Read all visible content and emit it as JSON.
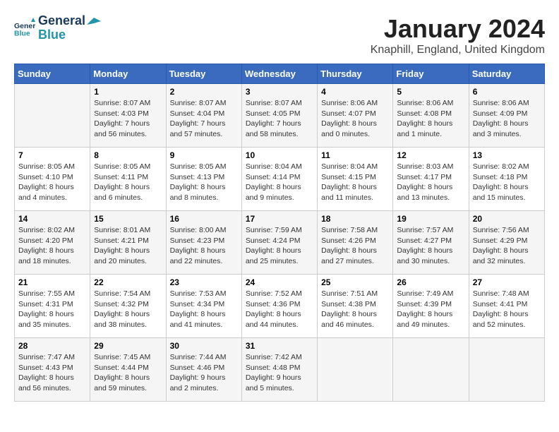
{
  "logo": {
    "line1": "General",
    "line2": "Blue"
  },
  "title": "January 2024",
  "subtitle": "Knaphill, England, United Kingdom",
  "weekdays": [
    "Sunday",
    "Monday",
    "Tuesday",
    "Wednesday",
    "Thursday",
    "Friday",
    "Saturday"
  ],
  "weeks": [
    [
      {
        "day": "",
        "info": ""
      },
      {
        "day": "1",
        "info": "Sunrise: 8:07 AM\nSunset: 4:03 PM\nDaylight: 7 hours\nand 56 minutes."
      },
      {
        "day": "2",
        "info": "Sunrise: 8:07 AM\nSunset: 4:04 PM\nDaylight: 7 hours\nand 57 minutes."
      },
      {
        "day": "3",
        "info": "Sunrise: 8:07 AM\nSunset: 4:05 PM\nDaylight: 7 hours\nand 58 minutes."
      },
      {
        "day": "4",
        "info": "Sunrise: 8:06 AM\nSunset: 4:07 PM\nDaylight: 8 hours\nand 0 minutes."
      },
      {
        "day": "5",
        "info": "Sunrise: 8:06 AM\nSunset: 4:08 PM\nDaylight: 8 hours\nand 1 minute."
      },
      {
        "day": "6",
        "info": "Sunrise: 8:06 AM\nSunset: 4:09 PM\nDaylight: 8 hours\nand 3 minutes."
      }
    ],
    [
      {
        "day": "7",
        "info": "Sunrise: 8:05 AM\nSunset: 4:10 PM\nDaylight: 8 hours\nand 4 minutes."
      },
      {
        "day": "8",
        "info": "Sunrise: 8:05 AM\nSunset: 4:11 PM\nDaylight: 8 hours\nand 6 minutes."
      },
      {
        "day": "9",
        "info": "Sunrise: 8:05 AM\nSunset: 4:13 PM\nDaylight: 8 hours\nand 8 minutes."
      },
      {
        "day": "10",
        "info": "Sunrise: 8:04 AM\nSunset: 4:14 PM\nDaylight: 8 hours\nand 9 minutes."
      },
      {
        "day": "11",
        "info": "Sunrise: 8:04 AM\nSunset: 4:15 PM\nDaylight: 8 hours\nand 11 minutes."
      },
      {
        "day": "12",
        "info": "Sunrise: 8:03 AM\nSunset: 4:17 PM\nDaylight: 8 hours\nand 13 minutes."
      },
      {
        "day": "13",
        "info": "Sunrise: 8:02 AM\nSunset: 4:18 PM\nDaylight: 8 hours\nand 15 minutes."
      }
    ],
    [
      {
        "day": "14",
        "info": "Sunrise: 8:02 AM\nSunset: 4:20 PM\nDaylight: 8 hours\nand 18 minutes."
      },
      {
        "day": "15",
        "info": "Sunrise: 8:01 AM\nSunset: 4:21 PM\nDaylight: 8 hours\nand 20 minutes."
      },
      {
        "day": "16",
        "info": "Sunrise: 8:00 AM\nSunset: 4:23 PM\nDaylight: 8 hours\nand 22 minutes."
      },
      {
        "day": "17",
        "info": "Sunrise: 7:59 AM\nSunset: 4:24 PM\nDaylight: 8 hours\nand 25 minutes."
      },
      {
        "day": "18",
        "info": "Sunrise: 7:58 AM\nSunset: 4:26 PM\nDaylight: 8 hours\nand 27 minutes."
      },
      {
        "day": "19",
        "info": "Sunrise: 7:57 AM\nSunset: 4:27 PM\nDaylight: 8 hours\nand 30 minutes."
      },
      {
        "day": "20",
        "info": "Sunrise: 7:56 AM\nSunset: 4:29 PM\nDaylight: 8 hours\nand 32 minutes."
      }
    ],
    [
      {
        "day": "21",
        "info": "Sunrise: 7:55 AM\nSunset: 4:31 PM\nDaylight: 8 hours\nand 35 minutes."
      },
      {
        "day": "22",
        "info": "Sunrise: 7:54 AM\nSunset: 4:32 PM\nDaylight: 8 hours\nand 38 minutes."
      },
      {
        "day": "23",
        "info": "Sunrise: 7:53 AM\nSunset: 4:34 PM\nDaylight: 8 hours\nand 41 minutes."
      },
      {
        "day": "24",
        "info": "Sunrise: 7:52 AM\nSunset: 4:36 PM\nDaylight: 8 hours\nand 44 minutes."
      },
      {
        "day": "25",
        "info": "Sunrise: 7:51 AM\nSunset: 4:38 PM\nDaylight: 8 hours\nand 46 minutes."
      },
      {
        "day": "26",
        "info": "Sunrise: 7:49 AM\nSunset: 4:39 PM\nDaylight: 8 hours\nand 49 minutes."
      },
      {
        "day": "27",
        "info": "Sunrise: 7:48 AM\nSunset: 4:41 PM\nDaylight: 8 hours\nand 52 minutes."
      }
    ],
    [
      {
        "day": "28",
        "info": "Sunrise: 7:47 AM\nSunset: 4:43 PM\nDaylight: 8 hours\nand 56 minutes."
      },
      {
        "day": "29",
        "info": "Sunrise: 7:45 AM\nSunset: 4:44 PM\nDaylight: 8 hours\nand 59 minutes."
      },
      {
        "day": "30",
        "info": "Sunrise: 7:44 AM\nSunset: 4:46 PM\nDaylight: 9 hours\nand 2 minutes."
      },
      {
        "day": "31",
        "info": "Sunrise: 7:42 AM\nSunset: 4:48 PM\nDaylight: 9 hours\nand 5 minutes."
      },
      {
        "day": "",
        "info": ""
      },
      {
        "day": "",
        "info": ""
      },
      {
        "day": "",
        "info": ""
      }
    ]
  ]
}
